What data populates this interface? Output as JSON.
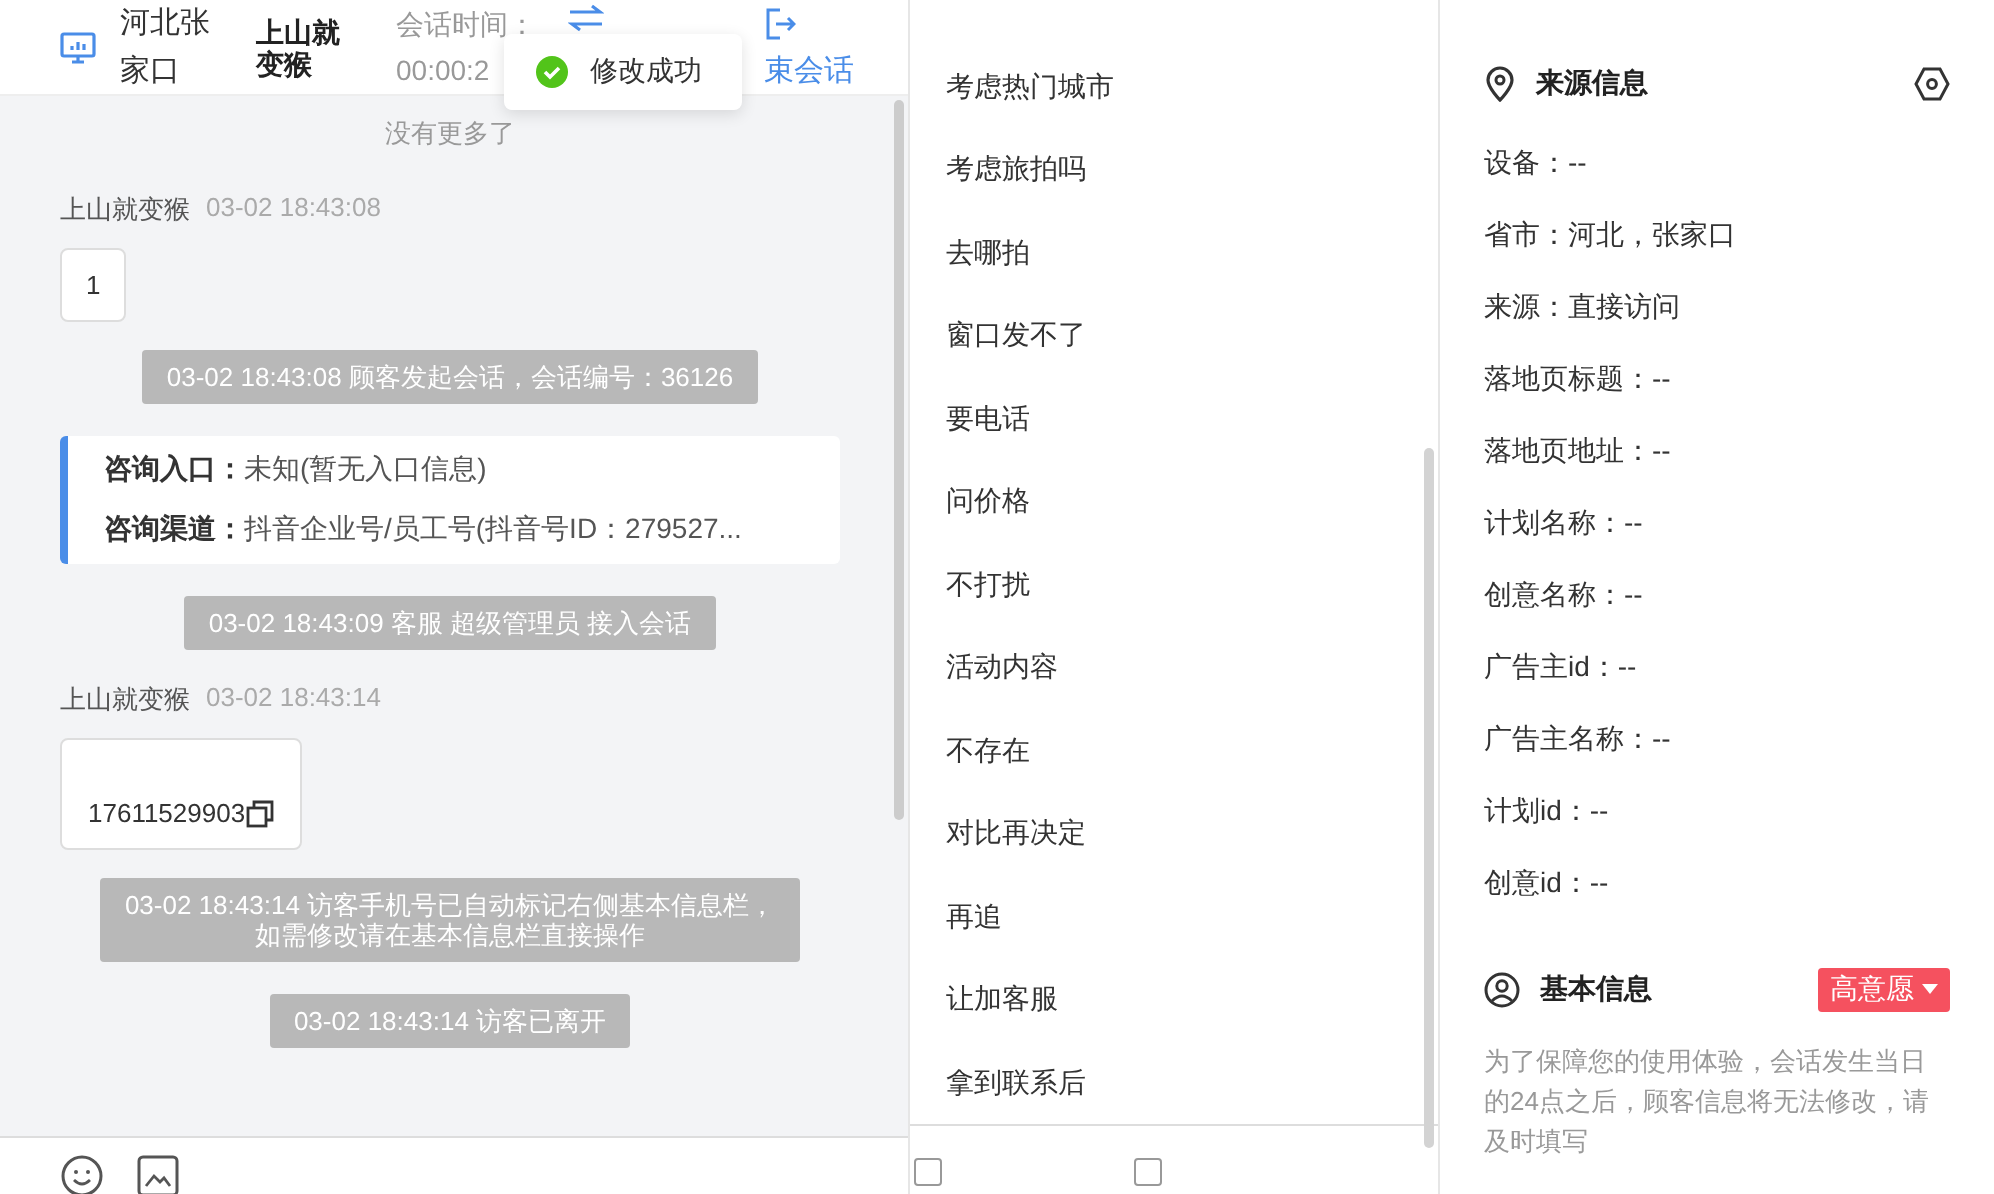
{
  "header": {
    "location": "河北张家口",
    "visitor": "上山就变猴",
    "time_label": "会话时间：",
    "time_value": "00:00:2",
    "end_label": "束会话"
  },
  "toast": {
    "text": "修改成功"
  },
  "chat": {
    "no_more": "没有更多了",
    "messages": [
      {
        "kind": "user",
        "name": "上山就变猴",
        "time": "03-02 18:43:08",
        "text": "1",
        "copy": false
      },
      {
        "kind": "notice",
        "lines": [
          "03-02 18:43:08 顾客发起会话，会话编号：36126"
        ]
      },
      {
        "kind": "info",
        "rows": [
          {
            "label": "咨询入口：",
            "value": "未知(暂无入口信息)"
          },
          {
            "label": "咨询渠道：",
            "value": "抖音企业号/员工号(抖音号ID：279527..."
          }
        ]
      },
      {
        "kind": "notice",
        "lines": [
          "03-02 18:43:09 客服 超级管理员 接入会话"
        ]
      },
      {
        "kind": "user",
        "name": "上山就变猴",
        "time": "03-02 18:43:14",
        "text": "17611529903",
        "copy": true
      },
      {
        "kind": "notice",
        "lines": [
          "03-02 18:43:14 访客手机号已自动标记右侧基本信息栏，",
          "如需修改请在基本信息栏直接操作"
        ]
      },
      {
        "kind": "notice",
        "lines": [
          "03-02 18:43:14 访客已离开"
        ]
      }
    ]
  },
  "quick_replies": [
    "考虑热门城市",
    "考虑旅拍吗",
    "去哪拍",
    "窗口发不了",
    "要电话",
    "问价格",
    "不打扰",
    "活动内容",
    "不存在",
    "对比再决定",
    "再追",
    "让加客服",
    "拿到联系后"
  ],
  "bottom_checkboxes": [
    {
      "checked": false
    },
    {
      "checked": false
    }
  ],
  "source_info": {
    "title": "来源信息",
    "rows": [
      "设备：--",
      "省市：河北，张家口",
      "来源：直接访问",
      "落地页标题：--",
      "落地页地址：--",
      "计划名称：--",
      "创意名称：--",
      "广告主id：--",
      "广告主名称：--",
      "计划id：--",
      "创意id：--"
    ]
  },
  "basic_info": {
    "title": "基本信息",
    "tag": "高意愿",
    "note": "为了保障您的使用体验，会话发生当日的24点之后，顾客信息将无法修改，请及时填写"
  }
}
